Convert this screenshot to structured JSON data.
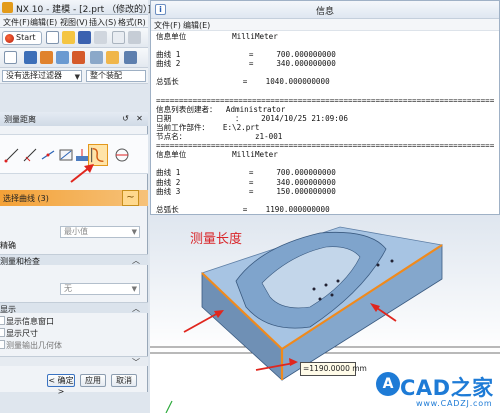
{
  "nx_window": {
    "title": "NX 10 - 建模 - [2.prt （修改的）]",
    "menu": [
      "文件(F)",
      "编辑(E)",
      "视图(V)",
      "插入(S)",
      "格式(R)"
    ],
    "start_label": "Start",
    "filter_placeholder": "没有选择过滤器",
    "assembly_scope": "整个装配"
  },
  "dialog": {
    "title": "测量距离",
    "section_curve_label": "选择曲线 (3)",
    "measure_dropdown": "最小值",
    "dropdown_none": "无",
    "partial_labels": {
      "accuracy": "精确",
      "flag_check": "测量和检查",
      "display": "显示",
      "info_window": "显示信息窗口",
      "dimension": "显示尺寸",
      "output": "测量输出几何体"
    },
    "ok_label": "< 确定 >",
    "apply_label": "应用",
    "cancel_label": "取消"
  },
  "info_window": {
    "title": "信息",
    "menu": [
      "文件(F)",
      "编辑(E)"
    ],
    "lines": [
      "信息单位          MilliMeter",
      "",
      "曲线 1               =     700.000000000",
      "曲线 2               =     340.000000000",
      "",
      "总弧长              =    1040.000000000",
      "",
      "==========================================================================",
      "信息列表创建者：  Administrator",
      "日期              ：    2014/10/25 21:09:06",
      "当前工作部件：   E:\\2.prt",
      "节点名：               z1-001",
      "==========================================================================",
      "信息单位          MilliMeter",
      "",
      "曲线 1               =     700.000000000",
      "曲线 2               =     340.000000000",
      "曲线 3               =     150.000000000",
      "",
      "总弧长              =    1190.000000000"
    ]
  },
  "viewport": {
    "annotation": "测量长度",
    "dimension_value": "=1190.0000 mm"
  },
  "watermark": {
    "logo_text": "CAD之家",
    "site": "www.CADZJ.com"
  },
  "colors": {
    "accent_orange": "#f3a137",
    "annotation_red": "#d9262a",
    "model_blue": "#8fb3d6",
    "watermark_blue": "#1e7bd6"
  }
}
